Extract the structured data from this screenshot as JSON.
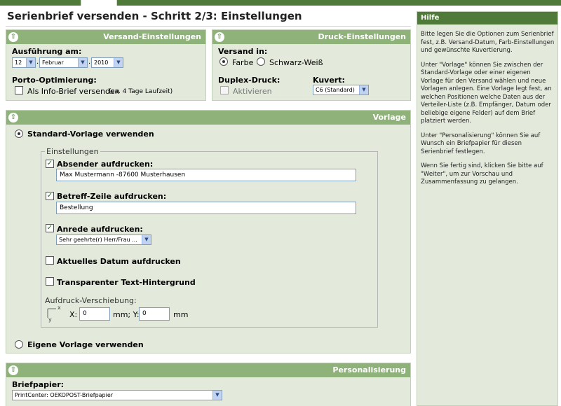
{
  "page": {
    "title": "Serienbrief versenden - Schritt 2/3: Einstellungen"
  },
  "versand": {
    "header": "Versand-Einstellungen",
    "ausfuehrung_label": "Ausführung am:",
    "day": "12",
    "month": "Februar",
    "year": "2010",
    "porto_label": "Porto-Optimierung:",
    "infobrief_label": "Als Info-Brief versenden",
    "infobrief_note": "(ca. 4 Tage Laufzeit)",
    "infobrief_checked": false
  },
  "druck": {
    "header": "Druck-Einstellungen",
    "versand_in_label": "Versand in:",
    "farbe_label": "Farbe",
    "sw_label": "Schwarz-Weiß",
    "selected_color": "Farbe",
    "duplex_label": "Duplex-Druck:",
    "aktivieren_label": "Aktivieren",
    "kuvert_label": "Kuvert:",
    "kuvert_value": "C6 (Standard)"
  },
  "vorlage": {
    "header": "Vorlage",
    "standard_label": "Standard-Vorlage verwenden",
    "einstellungen_legend": "Einstellungen",
    "absender_label": "Absender aufdrucken:",
    "absender_value": "Max Mustermann -87600 Musterhausen",
    "absender_checked": true,
    "betreff_label": "Betreff-Zeile aufdrucken:",
    "betreff_value": "Bestellung",
    "betreff_checked": true,
    "anrede_label": "Anrede aufdrucken:",
    "anrede_value": "Sehr geehrte(r) Herr/Frau ...",
    "anrede_checked": true,
    "datum_label": "Aktuelles Datum aufdrucken",
    "datum_checked": false,
    "transparent_label": "Transparenter Text-Hintergrund",
    "transparent_checked": false,
    "verschiebung_label": "Aufdruck-Verschiebung:",
    "axis_x": "x",
    "axis_y": "y",
    "x_label": "X:",
    "x_value": "0",
    "mm_y_label": "mm; Y:",
    "y_value": "0",
    "mm_label": "mm",
    "eigene_label": "Eigene Vorlage verwenden"
  },
  "personalisierung": {
    "header": "Personalisierung",
    "briefpapier_label": "Briefpapier:",
    "briefpapier_value": "PrintCenter: OEKOPOST-Briefpapier"
  },
  "help": {
    "header": "Hilfe",
    "p1": "Bitte legen Sie die Optionen zum Serienbrief fest, z.B. Versand-Datum, Farb-Einstellungen und gewünschte Kuvertierung.",
    "p2": "Unter \"Vorlage\" können Sie zwischen der Standard-Vorlage oder einer eigenen Vorlage für den Versand wählen und neue Vorlagen anlegen. Eine Vorlage legt fest, an welchen Positionen welche Daten aus der Verteiler-Liste (z.B. Empfänger, Datum oder beliebige eigene Felder) auf dem Brief platziert werden.",
    "p3": "Unter \"Personalisierung\" können Sie auf Wunsch ein Briefpapier für diesen Serienbrief festlegen.",
    "p4": "Wenn Sie fertig sind, klicken Sie bitte auf \"Weiter\", um zur Vorschau und Zusammenfassung zu gelangen."
  },
  "icons": {
    "collapse": "collapse-up-icon",
    "dropdown": "chevron-down-icon",
    "axis": "axis-icon"
  },
  "colors": {
    "header_green": "#8fb27a",
    "dark_green": "#4f7a3a",
    "panel_bg": "#e3eadc"
  }
}
